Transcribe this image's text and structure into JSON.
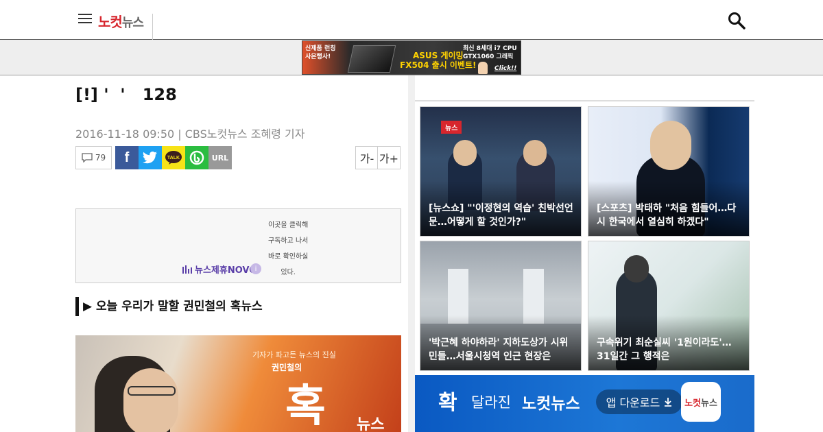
{
  "header": {
    "logo": {
      "part1": "노컷",
      "part2": "뉴스"
    },
    "menu_icon": "hamburger-icon",
    "search_icon": "search-icon"
  },
  "top_ad": {
    "line1a": "신제품 런칭",
    "line1b": "사은행사!",
    "product_a": "ASUS 게이밍",
    "product_b": "FX504 출시 이벤트!",
    "spec_a": "최신 8세대 i7 CPU",
    "spec_b": "GTX1060 그래픽",
    "cta": "Click!!"
  },
  "article": {
    "headline": "[!] '  '   128",
    "meta": "2016-11-18 09:50 | CBS노컷뉴스 조혜령 기자",
    "comment_count": "79",
    "share": {
      "facebook": "f",
      "url": "URL"
    },
    "font_minus": "가-",
    "font_plus": "가+"
  },
  "novo_ad": {
    "brand": "뉴스제휴NOVO",
    "info": "i",
    "text_lines": [
      "이곳을 클릭해",
      "구독하고 나서",
      "바로 확인하실",
      "있다."
    ]
  },
  "section_heading": "▶ 오늘 우리가 말할 권민철의 혹뉴스",
  "photo": {
    "caption1": "기자가 파고든 뉴스의 진실",
    "caption2": "권민철의",
    "big": "혹",
    "small": "뉴스"
  },
  "related": [
    {
      "title": "[뉴스쇼] \"'이정현의 역습' 친박선언문…어떻게 할 것인가?\"",
      "tag": "뉴스"
    },
    {
      "title": "[스포츠] 박태하 \"처음 힘들어…다시 한국에서 열심히 하겠다\""
    },
    {
      "title": "'박근혜 하야하라' 지하도상가 시위민들…서울시청역 인근 현장은"
    },
    {
      "title": "구속위기 최순실씨 '1원이라도'…31일간 그 행적은"
    }
  ],
  "promo": {
    "big": "확",
    "text1": "달라진",
    "text2": "노컷뉴스",
    "download": "앱 다운로드",
    "app_a": "노컷",
    "app_b": "뉴스"
  }
}
